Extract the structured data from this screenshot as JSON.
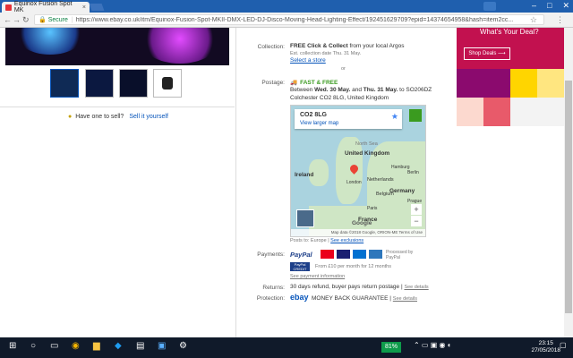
{
  "browser": {
    "tab_title": "Equinox Fusion Spot MK",
    "tab_close": "×",
    "address_secure": "Secure",
    "url": "https://www.ebay.co.uk/itm/Equinox-Fusion-Spot-MKII-DMX-LED-DJ-Disco-Moving-Head-Lighting-Effect/192451629709?epid=14374654958&hash=item2cc..."
  },
  "listing": {
    "sell": {
      "prompt": "Have one to sell?",
      "link": "Sell it yourself"
    },
    "collection": {
      "label": "Collection:",
      "title": "FREE Click & Collect",
      "rest": " from your local Argos",
      "est": "Est. collection date Thu. 31 May.",
      "select_store": "Select a store",
      "or": "or"
    },
    "postage": {
      "label": "Postage:",
      "badge": "FAST & FREE",
      "line1_pre": "Between ",
      "date1": "Wed. 30 May.",
      "and": " and ",
      "date2": "Thu. 31 May.",
      "to": " to SO206DZ",
      "line2": "Colchester CO2 8LG, United Kingdom"
    },
    "map": {
      "postcode": "CO2 8LG",
      "view_larger": "View larger map",
      "labels": {
        "north_sea": "North Sea",
        "uk": "United Kingdom",
        "ireland": "Ireland",
        "netherlands": "Netherlands",
        "london": "London",
        "belgium": "Belgium",
        "germany": "Germany",
        "paris": "Paris",
        "france": "France",
        "berlin": "Berlin",
        "hamburg": "Hamburg",
        "prague": "Prague"
      },
      "attribution": "Map data ©2018 Google, ORION-ME   Terms of Use",
      "zoom_in": "+",
      "zoom_out": "−",
      "google": "Google"
    },
    "posts_to": {
      "text": "Posts to:  Europe",
      "link": "See exclusions"
    },
    "payments": {
      "label": "Payments:",
      "paypal": "PayPal",
      "processed": "Processed by PayPal",
      "credit_logo": "PayPal CREDIT",
      "credit_text": "From £10 per month for 12 months",
      "details_link": "See payment information"
    },
    "returns": {
      "label": "Returns:",
      "text": "30 days refund, buyer pays return postage",
      "link": "See details"
    },
    "protection": {
      "label": "Protection:",
      "ebay": "ebay",
      "text": "MONEY BACK GUARANTEE",
      "link": "See details"
    }
  },
  "ad": {
    "headline": "What's Your Deal?",
    "button": "Shop Deals ⟶"
  },
  "taskbar": {
    "battery": "81%",
    "time": "23:15",
    "date": "27/05/2018"
  }
}
